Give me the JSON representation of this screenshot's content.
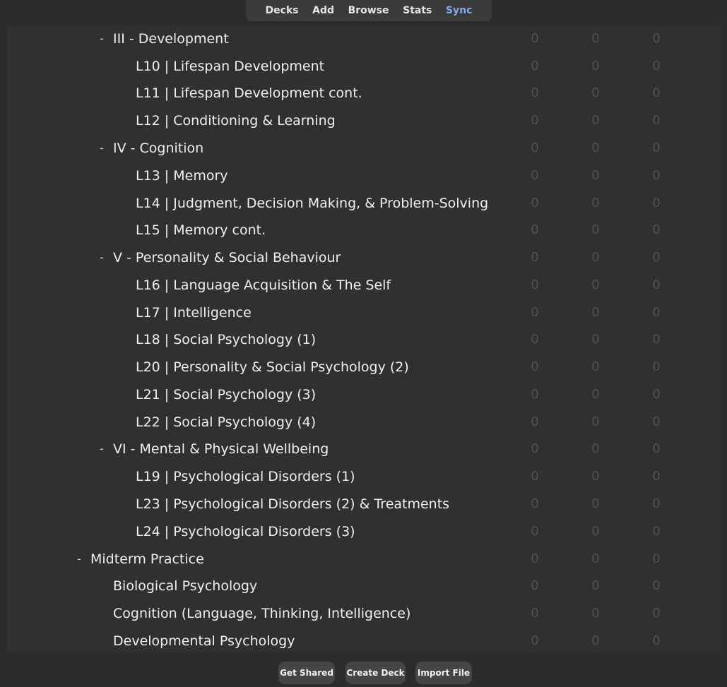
{
  "toolbar": {
    "decks": "Decks",
    "add": "Add",
    "browse": "Browse",
    "stats": "Stats",
    "sync": "Sync"
  },
  "collapse_symbol": "-",
  "decks": [
    {
      "name": "III - Development",
      "collapsible": true,
      "new": "0",
      "learn": "0",
      "due": "0"
    },
    {
      "name": "L10 | Lifespan Development",
      "collapsible": false,
      "new": "0",
      "learn": "0",
      "due": "0"
    },
    {
      "name": "L11 | Lifespan Development cont.",
      "collapsible": false,
      "new": "0",
      "learn": "0",
      "due": "0"
    },
    {
      "name": "L12 | Conditioning & Learning",
      "collapsible": false,
      "new": "0",
      "learn": "0",
      "due": "0"
    },
    {
      "name": "IV - Cognition",
      "collapsible": true,
      "new": "0",
      "learn": "0",
      "due": "0"
    },
    {
      "name": "L13 | Memory",
      "collapsible": false,
      "new": "0",
      "learn": "0",
      "due": "0"
    },
    {
      "name": "L14 | Judgment, Decision Making, & Problem-Solving",
      "collapsible": false,
      "new": "0",
      "learn": "0",
      "due": "0"
    },
    {
      "name": "L15 | Memory cont.",
      "collapsible": false,
      "new": "0",
      "learn": "0",
      "due": "0"
    },
    {
      "name": "V - Personality & Social Behaviour",
      "collapsible": true,
      "new": "0",
      "learn": "0",
      "due": "0"
    },
    {
      "name": "L16 | Language Acquisition & The Self",
      "collapsible": false,
      "new": "0",
      "learn": "0",
      "due": "0"
    },
    {
      "name": "L17 | Intelligence",
      "collapsible": false,
      "new": "0",
      "learn": "0",
      "due": "0"
    },
    {
      "name": "L18 | Social Psychology (1)",
      "collapsible": false,
      "new": "0",
      "learn": "0",
      "due": "0"
    },
    {
      "name": "L20 | Personality & Social Psychology (2)",
      "collapsible": false,
      "new": "0",
      "learn": "0",
      "due": "0"
    },
    {
      "name": "L21 | Social Psychology (3)",
      "collapsible": false,
      "new": "0",
      "learn": "0",
      "due": "0"
    },
    {
      "name": "L22 | Social Psychology (4)",
      "collapsible": false,
      "new": "0",
      "learn": "0",
      "due": "0"
    },
    {
      "name": "VI - Mental & Physical Wellbeing",
      "collapsible": true,
      "new": "0",
      "learn": "0",
      "due": "0"
    },
    {
      "name": "L19 | Psychological Disorders (1)",
      "collapsible": false,
      "new": "0",
      "learn": "0",
      "due": "0"
    },
    {
      "name": "L23 | Psychological Disorders (2) & Treatments",
      "collapsible": false,
      "new": "0",
      "learn": "0",
      "due": "0"
    },
    {
      "name": "L24 | Psychological Disorders (3)",
      "collapsible": false,
      "new": "0",
      "learn": "0",
      "due": "0"
    },
    {
      "name": "Midterm Practice",
      "collapsible": true,
      "new": "0",
      "learn": "0",
      "due": "0"
    },
    {
      "name": "Biological Psychology",
      "collapsible": false,
      "new": "0",
      "learn": "0",
      "due": "0"
    },
    {
      "name": "Cognition (Language, Thinking, Intelligence)",
      "collapsible": false,
      "new": "0",
      "learn": "0",
      "due": "0"
    },
    {
      "name": "Developmental Psychology",
      "collapsible": false,
      "new": "0",
      "learn": "0",
      "due": "0"
    }
  ],
  "bottom": {
    "get_shared": "Get Shared",
    "create_deck": "Create Deck",
    "import_file": "Import File"
  },
  "colors": {
    "background": "#2c2c2c",
    "toolbar": "#3b3b3b",
    "sync_accent": "#84a9e6",
    "count_zero": "#515151"
  }
}
